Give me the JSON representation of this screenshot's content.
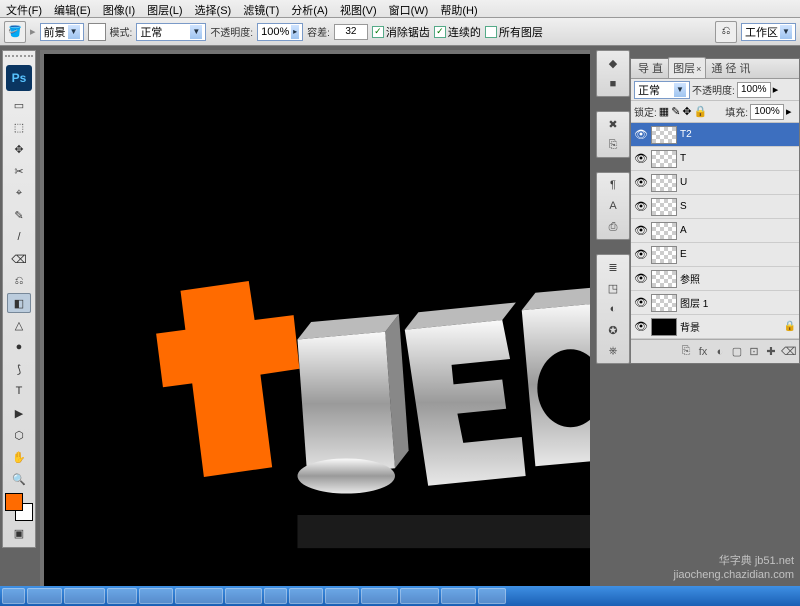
{
  "menu": {
    "items": [
      "文件(F)",
      "编辑(E)",
      "图像(I)",
      "图层(L)",
      "选择(S)",
      "滤镜(T)",
      "分析(A)",
      "视图(V)",
      "窗口(W)",
      "帮助(H)"
    ]
  },
  "options": {
    "fill_label": "前景",
    "mode_label": "模式:",
    "mode_value": "正常",
    "opacity_label": "不透明度:",
    "opacity_value": "100%",
    "tolerance_label": "容差:",
    "tolerance_value": "32",
    "antialias": "消除锯齿",
    "contiguous": "连续的",
    "all_layers": "所有图层",
    "workspace": "工作区"
  },
  "tools": [
    "▭",
    "⬚",
    "✥",
    "✂",
    "⌖",
    "✎",
    "/",
    "⌫",
    "⎌",
    "◧",
    "△",
    "●",
    "⟆",
    "T",
    "▶",
    "⬡",
    "✋",
    "🔍"
  ],
  "fg_color": "#ff6b00",
  "right_groups": [
    [
      "◆",
      "■"
    ],
    [
      "✖",
      "⎘"
    ],
    [
      "¶",
      "A",
      "⎙"
    ],
    [
      "≣",
      "◳",
      "◐",
      "✪",
      "⎈"
    ]
  ],
  "layers_panel": {
    "tabs": [
      "导 直",
      "图层",
      "通 径 讯"
    ],
    "active_tab": 1,
    "blend": "正常",
    "opacity_label": "不透明度:",
    "opacity_value": "100%",
    "lock_label": "锁定:",
    "fill_label": "填充:",
    "fill_value": "100%",
    "items": [
      {
        "name": "T2",
        "active": true
      },
      {
        "name": "T"
      },
      {
        "name": "U"
      },
      {
        "name": "S"
      },
      {
        "name": "A"
      },
      {
        "name": "E"
      },
      {
        "name": "参照"
      },
      {
        "name": "图层 1"
      },
      {
        "name": "背景",
        "locked": true,
        "black": true
      }
    ],
    "bottom_icons": [
      "⎘",
      "fx",
      "◐",
      "▢",
      "⊡",
      "✚",
      "⌫"
    ]
  },
  "watermark": {
    "l1": "华字典 jb51.net",
    "l2": "jiaocheng.chazidian.com"
  },
  "taskbar_items": 14
}
